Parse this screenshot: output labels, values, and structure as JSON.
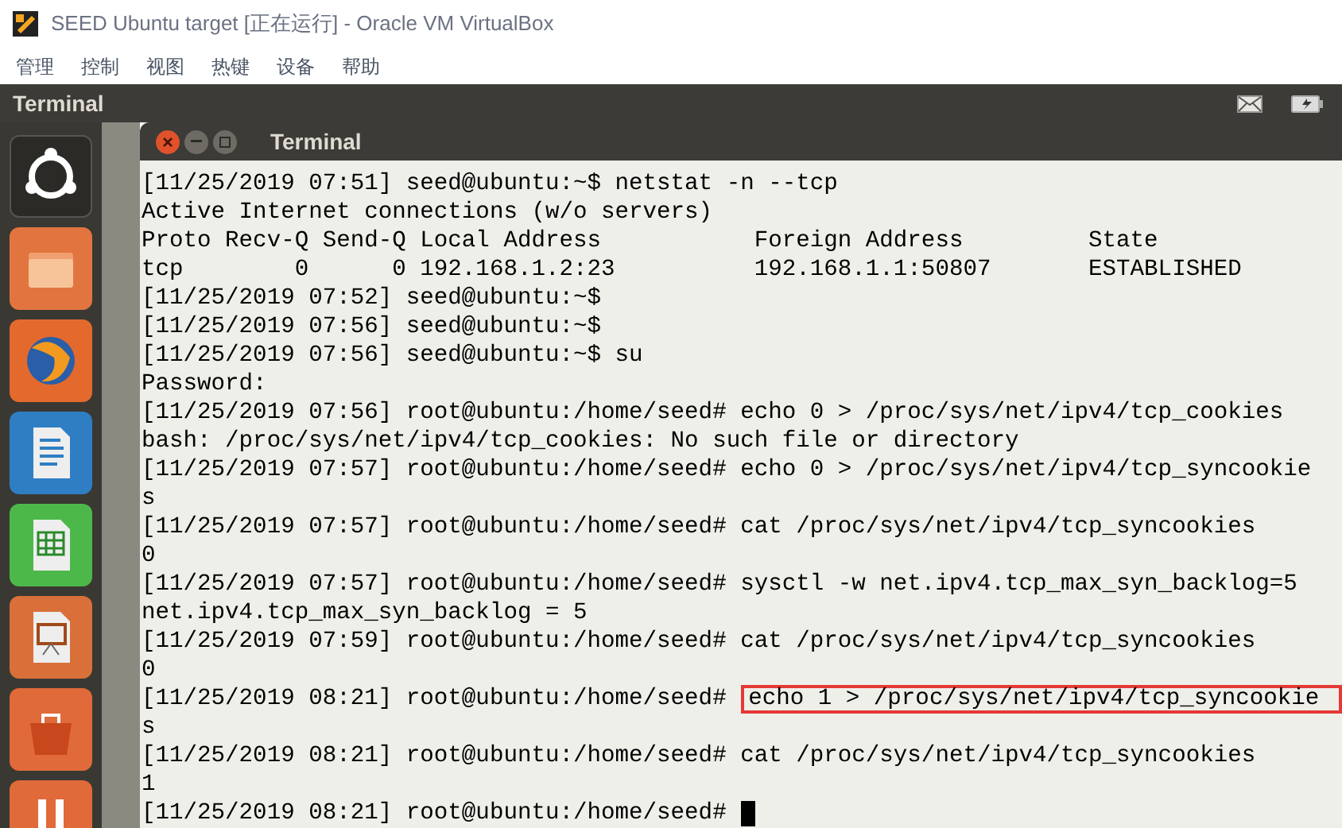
{
  "window": {
    "title": "SEED Ubuntu target [正在运行] - Oracle VM VirtualBox"
  },
  "menu": [
    "管理",
    "控制",
    "视图",
    "热键",
    "设备",
    "帮助"
  ],
  "panel": {
    "title": "Terminal"
  },
  "launcher": [
    {
      "kind": "dash"
    },
    {
      "kind": "folder"
    },
    {
      "kind": "browser"
    },
    {
      "kind": "writer"
    },
    {
      "kind": "calc"
    },
    {
      "kind": "impress"
    },
    {
      "kind": "store"
    },
    {
      "kind": "other"
    }
  ],
  "terminal": {
    "title": "Terminal",
    "lines": [
      {
        "text": "[11/25/2019 07:51] seed@ubuntu:~$ netstat -n --tcp"
      },
      {
        "text": "Active Internet connections (w/o servers)"
      },
      {
        "text": "Proto Recv-Q Send-Q Local Address           Foreign Address         State"
      },
      {
        "text": "tcp        0      0 192.168.1.2:23          192.168.1.1:50807       ESTABLISHED"
      },
      {
        "text": "[11/25/2019 07:52] seed@ubuntu:~$"
      },
      {
        "text": "[11/25/2019 07:56] seed@ubuntu:~$"
      },
      {
        "text": "[11/25/2019 07:56] seed@ubuntu:~$ su"
      },
      {
        "text": "Password:"
      },
      {
        "text": "[11/25/2019 07:56] root@ubuntu:/home/seed# echo 0 > /proc/sys/net/ipv4/tcp_cookies"
      },
      {
        "text": "bash: /proc/sys/net/ipv4/tcp_cookies: No such file or directory"
      },
      {
        "text": "[11/25/2019 07:57] root@ubuntu:/home/seed# echo 0 > /proc/sys/net/ipv4/tcp_syncookie"
      },
      {
        "text": "s"
      },
      {
        "text": "[11/25/2019 07:57] root@ubuntu:/home/seed# cat /proc/sys/net/ipv4/tcp_syncookies"
      },
      {
        "text": "0"
      },
      {
        "text": "[11/25/2019 07:57] root@ubuntu:/home/seed# sysctl -w net.ipv4.tcp_max_syn_backlog=5"
      },
      {
        "text": "net.ipv4.tcp_max_syn_backlog = 5"
      },
      {
        "text": "[11/25/2019 07:59] root@ubuntu:/home/seed# cat /proc/sys/net/ipv4/tcp_syncookies"
      },
      {
        "text": "0"
      },
      {
        "text": "[11/25/2019 08:21] root@ubuntu:/home/seed# ",
        "marked": "echo 1 > /proc/sys/net/ipv4/tcp_syncookie"
      },
      {
        "text": "s"
      },
      {
        "text": "[11/25/2019 08:21] root@ubuntu:/home/seed# cat /proc/sys/net/ipv4/tcp_syncookies"
      },
      {
        "text": "1"
      },
      {
        "text": "[11/25/2019 08:21] root@ubuntu:/home/seed# ",
        "cursor": true
      }
    ]
  }
}
